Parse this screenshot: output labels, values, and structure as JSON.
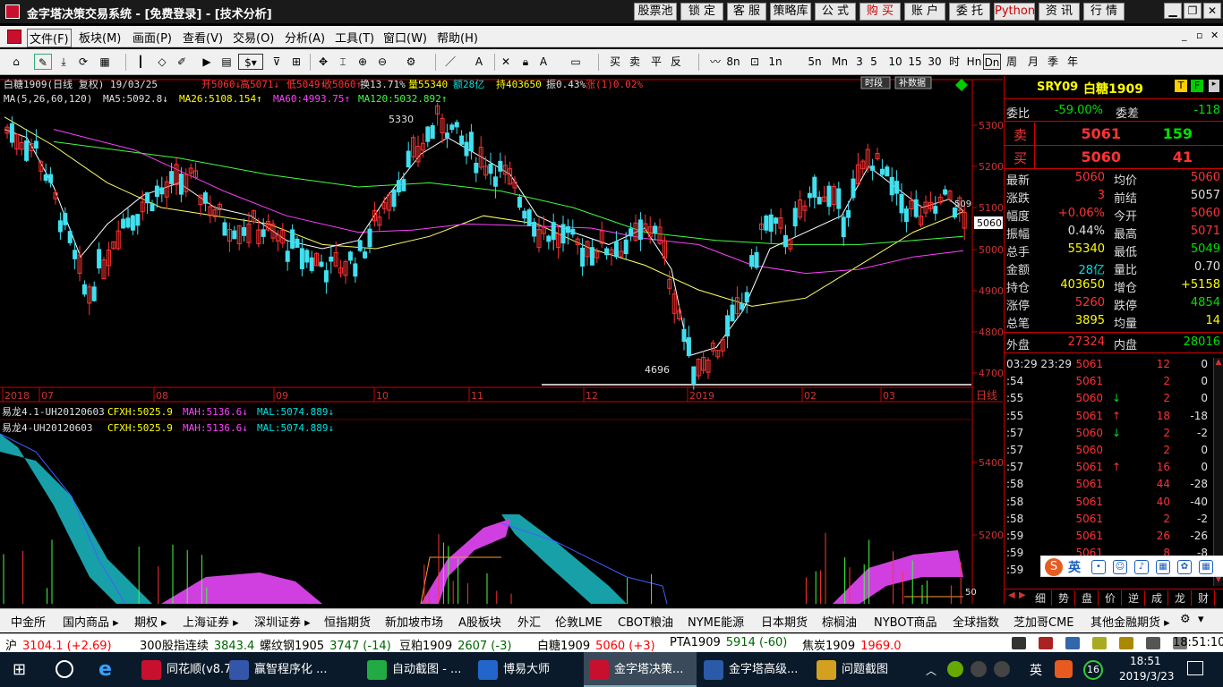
{
  "window": {
    "title": "金字塔决策交易系统 - [免费登录] - [技术分析]"
  },
  "top_buttons": [
    "股票池",
    "锁 定",
    "客 服",
    "策略库",
    "公 式",
    "购 买",
    "账 户",
    "委 托",
    "Python",
    "资 讯",
    "行 情"
  ],
  "menu": [
    "文件(F)",
    "板块(M)",
    "画面(P)",
    "查看(V)",
    "交易(O)",
    "分析(A)",
    "工具(T)",
    "窗口(W)",
    "帮助(H)"
  ],
  "toolbar_periods": [
    "1n",
    "5n",
    "Mn",
    "3",
    "5",
    "10",
    "15",
    "30",
    "时",
    "Hn",
    "Dn",
    "周",
    "月",
    "季",
    "年"
  ],
  "toolbar_orders": [
    "买",
    "卖",
    "平",
    "反"
  ],
  "toolbar_line1": "8n",
  "main_header": {
    "symbol": "白糖1909(日线 复权) 19/03/25",
    "open": "开5060↓",
    "high": "高5071↓",
    "low": "低5049↑",
    "close": "收5060↑",
    "turnover": "换13.71%",
    "volume": "量55340",
    "amount": "额28亿",
    "oi": "持403650",
    "amp": "振0.43%",
    "chg": "涨(1)0.02%",
    "btn_time": "时段",
    "btn_restore": "补数据"
  },
  "ma_line": {
    "label": "MA(5,26,60,120)",
    "ma5": "MA5:5092.8↓",
    "ma26": "MA26:5108.154↑",
    "ma60": "MA60:4993.75↑",
    "ma120": "MA120:5032.892↑"
  },
  "main_price_axis": [
    "5300",
    "5200",
    "5100",
    "5000",
    "4900",
    "4800",
    "4700"
  ],
  "price_marks": {
    "high": "5330",
    "low": "4696",
    "last": "5060",
    "last_right": "509"
  },
  "date_axis": [
    "2018",
    "07",
    "08",
    "09",
    "10",
    "11",
    "12",
    "2019",
    "02",
    "03"
  ],
  "date_axis_end": "日线",
  "sub_header1": {
    "name": "易龙4.1-UH20120603",
    "cfxh": "CFXH:5025.9",
    "mah": "MAH:5136.6↓",
    "mal": "MAL:5074.889↓"
  },
  "sub_header2": {
    "name": "易龙4-UH20120603",
    "cfxh": "CFXH:5025.9",
    "mah": "MAH:5136.6↓",
    "mal": "MAL:5074.889↓"
  },
  "sub_axis": [
    "5400",
    "5200"
  ],
  "sub_axis_last": "50",
  "quote": {
    "code": "SRY09",
    "name": "白糖1909",
    "webi_label": "委比",
    "webi": "-59.00%",
    "weicha_label": "委差",
    "weicha": "-118",
    "sell_label": "卖",
    "sell_price": "5061",
    "sell_vol": "159",
    "buy_label": "买",
    "buy_price": "5060",
    "buy_vol": "41",
    "rows": [
      {
        "l1": "最新",
        "v1": "5060",
        "c1": "red",
        "l2": "均价",
        "v2": "5060",
        "c2": "red"
      },
      {
        "l1": "涨跌",
        "v1": "3",
        "c1": "red",
        "l2": "前结",
        "v2": "5057",
        "c2": "wht"
      },
      {
        "l1": "幅度",
        "v1": "+0.06%",
        "c1": "red",
        "l2": "今开",
        "v2": "5060",
        "c2": "red"
      },
      {
        "l1": "振幅",
        "v1": "0.44%",
        "c1": "wht",
        "l2": "最高",
        "v2": "5071",
        "c2": "red"
      },
      {
        "l1": "总手",
        "v1": "55340",
        "c1": "yel",
        "l2": "最低",
        "v2": "5049",
        "c2": "grn"
      },
      {
        "l1": "金额",
        "v1": "28亿",
        "c1": "cyan",
        "l2": "量比",
        "v2": "0.70",
        "c2": "wht"
      },
      {
        "l1": "持仓",
        "v1": "403650",
        "c1": "yel",
        "l2": "增仓",
        "v2": "+5158",
        "c2": "yel"
      },
      {
        "l1": "涨停",
        "v1": "5260",
        "c1": "red",
        "l2": "跌停",
        "v2": "4854",
        "c2": "grn"
      },
      {
        "l1": "总笔",
        "v1": "3895",
        "c1": "yel",
        "l2": "均量",
        "v2": "14",
        "c2": "yel"
      }
    ],
    "outer_label": "外盘",
    "outer": "27324",
    "inner_label": "内盘",
    "inner": "28016"
  },
  "ticks": [
    {
      "t": "03:29 23:29",
      "p": "5061",
      "d": "",
      "v": "12",
      "o": "0",
      "pc": "red"
    },
    {
      "t": ":54",
      "p": "5061",
      "d": "",
      "v": "2",
      "o": "0",
      "pc": "red"
    },
    {
      "t": ":55",
      "p": "5060",
      "d": "↓",
      "v": "2",
      "o": "0",
      "pc": "red"
    },
    {
      "t": ":55",
      "p": "5061",
      "d": "↑",
      "v": "18",
      "o": "-18",
      "pc": "red"
    },
    {
      "t": ":57",
      "p": "5060",
      "d": "↓",
      "v": "2",
      "o": "-2",
      "pc": "red"
    },
    {
      "t": ":57",
      "p": "5060",
      "d": "",
      "v": "2",
      "o": "0",
      "pc": "red"
    },
    {
      "t": ":57",
      "p": "5061",
      "d": "↑",
      "v": "16",
      "o": "0",
      "pc": "red"
    },
    {
      "t": ":58",
      "p": "5061",
      "d": "",
      "v": "44",
      "o": "-28",
      "pc": "red"
    },
    {
      "t": ":58",
      "p": "5061",
      "d": "",
      "v": "40",
      "o": "-40",
      "pc": "red"
    },
    {
      "t": ":58",
      "p": "5061",
      "d": "",
      "v": "2",
      "o": "-2",
      "pc": "red"
    },
    {
      "t": ":59",
      "p": "5061",
      "d": "",
      "v": "26",
      "o": "-26",
      "pc": "red"
    },
    {
      "t": ":59",
      "p": "5061",
      "d": "",
      "v": "8",
      "o": "-8",
      "pc": "red"
    },
    {
      "t": ":59",
      "p": "",
      "d": "",
      "v": "",
      "o": "",
      "pc": "red"
    }
  ],
  "ime": {
    "label": "英"
  },
  "bottom_mini_tabs": [
    "细",
    "势",
    "盘",
    "价",
    "逆",
    "成",
    "龙",
    "财"
  ],
  "market_tabs": [
    "中金所",
    "国内商品 ▸",
    "期权 ▸",
    "上海证券 ▸",
    "深圳证券 ▸",
    "恒指期货",
    "新加坡市场",
    "A股板块",
    "外汇",
    "伦敦LME",
    "CBOT粮油",
    "NYME能源",
    "日本期货",
    "棕榈油",
    "NYBOT商品",
    "全球指数",
    "芝加哥CME",
    "其他金融期货 ▸"
  ],
  "ticker": [
    {
      "name": "沪",
      "val": "3104.1 (+2.69)",
      "c": "red"
    },
    {
      "name": "300股指连续",
      "val": "3843.4",
      "c": "#006600"
    },
    {
      "name": "螺纹钢1905",
      "val": "3747 (-14)",
      "c": "#006600"
    },
    {
      "name": "豆粕1909",
      "val": "2607 (-3)",
      "c": "#006600"
    },
    {
      "name": "白糖1909",
      "val": "5060 (+3)",
      "c": "red"
    },
    {
      "name": "PTA1909",
      "val": "5914 (-60)",
      "c": "#006600"
    },
    {
      "name": "焦炭1909",
      "val": "1969.0",
      "c": "red"
    }
  ],
  "clock": "18:51:10",
  "taskbar": {
    "apps": [
      "同花顺(v8.70...",
      "赢智程序化 ...",
      "自动截图 - ...",
      "博易大师",
      "金字塔决策...",
      "金字塔高级...",
      "问题截图"
    ],
    "time": "18:51",
    "date": "2019/3/23",
    "lang": "英",
    "notif": "16"
  }
}
